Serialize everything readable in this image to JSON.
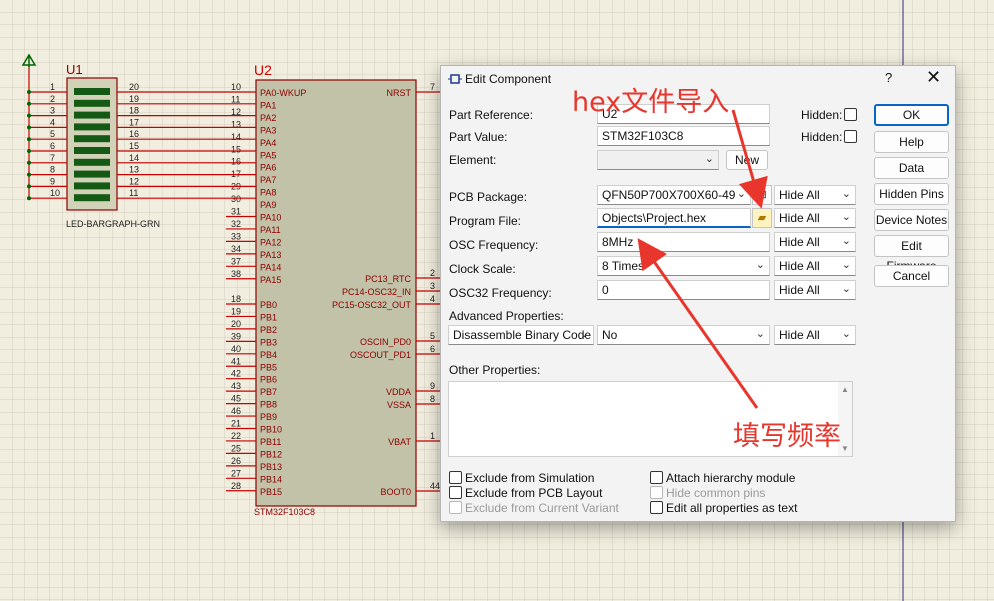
{
  "schematic": {
    "u1": {
      "ref": "U1",
      "name": "LED-BARGRAPH-GRN",
      "left_pins": [
        "1",
        "2",
        "3",
        "4",
        "5",
        "6",
        "7",
        "8",
        "9",
        "10"
      ],
      "right_pins": [
        "20",
        "19",
        "18",
        "17",
        "16",
        "15",
        "14",
        "13",
        "12",
        "11"
      ]
    },
    "u2": {
      "ref": "U2",
      "name": "STM32F103C8",
      "left": [
        {
          "num": "10",
          "name": "PA0-WKUP"
        },
        {
          "num": "11",
          "name": "PA1"
        },
        {
          "num": "12",
          "name": "PA2"
        },
        {
          "num": "13",
          "name": "PA3"
        },
        {
          "num": "14",
          "name": "PA4"
        },
        {
          "num": "15",
          "name": "PA5"
        },
        {
          "num": "16",
          "name": "PA6"
        },
        {
          "num": "17",
          "name": "PA7"
        },
        {
          "num": "29",
          "name": "PA8"
        },
        {
          "num": "30",
          "name": "PA9"
        },
        {
          "num": "31",
          "name": "PA10"
        },
        {
          "num": "32",
          "name": "PA11"
        },
        {
          "num": "33",
          "name": "PA12"
        },
        {
          "num": "34",
          "name": "PA13"
        },
        {
          "num": "37",
          "name": "PA14"
        },
        {
          "num": "38",
          "name": "PA15"
        },
        {
          "num": "18",
          "name": "PB0"
        },
        {
          "num": "19",
          "name": "PB1"
        },
        {
          "num": "20",
          "name": "PB2"
        },
        {
          "num": "39",
          "name": "PB3"
        },
        {
          "num": "40",
          "name": "PB4"
        },
        {
          "num": "41",
          "name": "PB5"
        },
        {
          "num": "42",
          "name": "PB6"
        },
        {
          "num": "43",
          "name": "PB7"
        },
        {
          "num": "45",
          "name": "PB8"
        },
        {
          "num": "46",
          "name": "PB9"
        },
        {
          "num": "21",
          "name": "PB10"
        },
        {
          "num": "22",
          "name": "PB11"
        },
        {
          "num": "25",
          "name": "PB12"
        },
        {
          "num": "26",
          "name": "PB13"
        },
        {
          "num": "27",
          "name": "PB14"
        },
        {
          "num": "28",
          "name": "PB15"
        }
      ],
      "right": [
        {
          "num": "7",
          "name": "NRST"
        },
        {
          "num": "2",
          "name": "PC13_RTC"
        },
        {
          "num": "3",
          "name": "PC14-OSC32_IN"
        },
        {
          "num": "4",
          "name": "PC15-OSC32_OUT"
        },
        {
          "num": "5",
          "name": "OSCIN_PD0"
        },
        {
          "num": "6",
          "name": "OSCOUT_PD1"
        },
        {
          "num": "9",
          "name": "VDDA"
        },
        {
          "num": "8",
          "name": "VSSA"
        },
        {
          "num": "1",
          "name": "VBAT"
        },
        {
          "num": "44",
          "name": "BOOT0"
        }
      ]
    }
  },
  "dialog": {
    "title": "Edit Component",
    "help": "?",
    "close": "✕",
    "part_reference": {
      "label": "Part Reference:",
      "value": "U2",
      "hidden_label": "Hidden:"
    },
    "part_value": {
      "label": "Part Value:",
      "value": "STM32F103C8",
      "hidden_label": "Hidden:"
    },
    "element": {
      "label": "Element:",
      "value": "",
      "new_button": "New"
    },
    "pcb_package": {
      "label": "PCB Package:",
      "value": "QFN50P700X700X60-49",
      "visibility": "Hide All"
    },
    "program_file": {
      "label": "Program File:",
      "value": "Objects\\Project.hex",
      "visibility": "Hide All"
    },
    "osc_frequency": {
      "label": "OSC Frequency:",
      "value": "8MHz",
      "visibility": "Hide All"
    },
    "clock_scale": {
      "label": "Clock Scale:",
      "value": "8 Times",
      "visibility": "Hide All"
    },
    "osc32_frequency": {
      "label": "OSC32 Frequency:",
      "value": "0",
      "visibility": "Hide All"
    },
    "advanced": {
      "label": "Advanced Properties:",
      "property": "Disassemble Binary Code",
      "value": "No",
      "visibility": "Hide All"
    },
    "other_properties": {
      "label": "Other Properties:"
    },
    "options": {
      "exclude_simulation": "Exclude from Simulation",
      "exclude_pcb": "Exclude from PCB Layout",
      "exclude_variant": "Exclude from Current Variant",
      "attach_hierarchy": "Attach hierarchy module",
      "hide_common_pins": "Hide common pins",
      "edit_all_text": "Edit all properties as text"
    },
    "buttons": {
      "ok": "OK",
      "help": "Help",
      "data": "Data",
      "hidden_pins": "Hidden Pins",
      "device_notes": "Device Notes",
      "edit_firmware": "Edit Firmware",
      "cancel": "Cancel"
    }
  },
  "annotations": {
    "hex_import": "hex文件导入",
    "fill_frequency": "填写频率",
    "color": "#e8362c"
  },
  "colors": {
    "canvas": "#f2eedf",
    "grid": "#c9c6b8",
    "wire": "#c80000",
    "chip_body": "#c2c2a8",
    "chip_border": "#8b0000",
    "label": "#8b0000",
    "accent": "#0a64c8"
  }
}
